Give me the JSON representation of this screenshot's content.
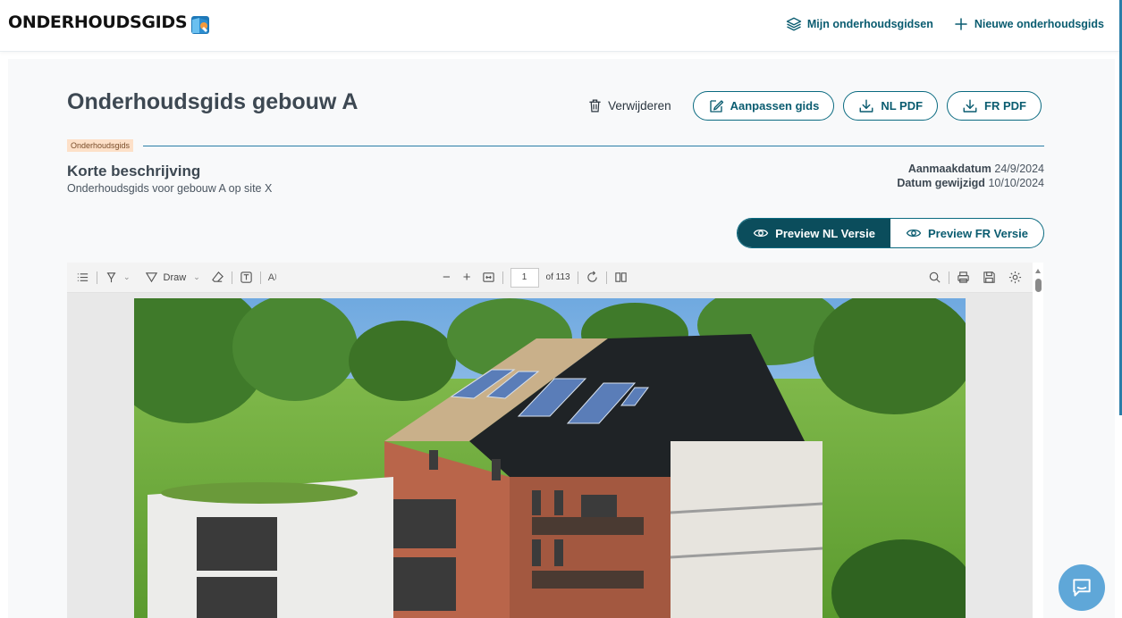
{
  "header": {
    "logo_text": "ONDERHOUDSGIDS",
    "nav": {
      "my_guides": "Mijn onderhoudsgidsen",
      "new_guide": "Nieuwe onderhoudsgids"
    }
  },
  "page": {
    "title": "Onderhoudsgids gebouw A",
    "actions": {
      "delete": "Verwijderen",
      "edit": "Aanpassen gids",
      "nl_pdf": "NL PDF",
      "fr_pdf": "FR PDF"
    },
    "tag": "Onderhoudsgids",
    "description_title": "Korte beschrijving",
    "description_text": "Onderhoudsgids voor gebouw A op site X",
    "created_label": "Aanmaakdatum",
    "created_value": "24/9/2024",
    "modified_label": "Datum gewijzigd",
    "modified_value": "10/10/2024"
  },
  "preview_toggle": {
    "nl": "Preview NL Versie",
    "fr": "Preview FR Versie",
    "active": "nl"
  },
  "pdf_viewer": {
    "draw_label": "Draw",
    "current_page": "1",
    "page_total": "of 113"
  },
  "colors": {
    "primary": "#0a5c70",
    "primary_dark": "#0b4d5c",
    "tag_bg": "#fde0c8",
    "accent_line": "#2a7ea8",
    "chat_button": "#5fa7d8"
  },
  "icons": [
    "layers-icon",
    "plus-icon",
    "trash-icon",
    "edit-icon",
    "download-icon",
    "eye-icon",
    "chat-icon"
  ]
}
